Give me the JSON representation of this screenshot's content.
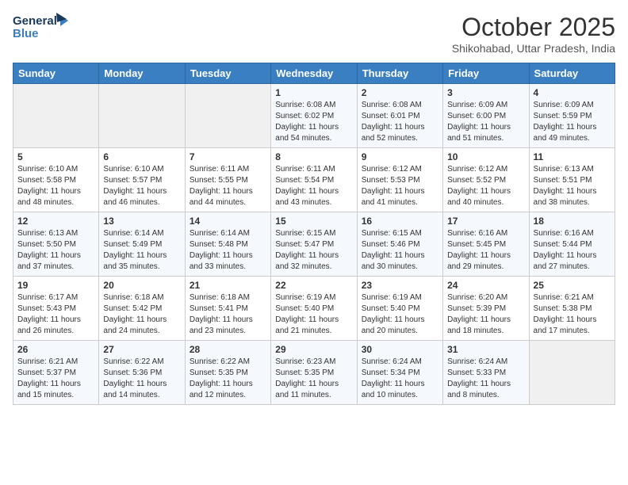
{
  "header": {
    "logo_line1": "General",
    "logo_line2": "Blue",
    "month": "October 2025",
    "location": "Shikohabad, Uttar Pradesh, India"
  },
  "weekdays": [
    "Sunday",
    "Monday",
    "Tuesday",
    "Wednesday",
    "Thursday",
    "Friday",
    "Saturday"
  ],
  "weeks": [
    [
      {
        "day": "",
        "info": ""
      },
      {
        "day": "",
        "info": ""
      },
      {
        "day": "",
        "info": ""
      },
      {
        "day": "1",
        "info": "Sunrise: 6:08 AM\nSunset: 6:02 PM\nDaylight: 11 hours\nand 54 minutes."
      },
      {
        "day": "2",
        "info": "Sunrise: 6:08 AM\nSunset: 6:01 PM\nDaylight: 11 hours\nand 52 minutes."
      },
      {
        "day": "3",
        "info": "Sunrise: 6:09 AM\nSunset: 6:00 PM\nDaylight: 11 hours\nand 51 minutes."
      },
      {
        "day": "4",
        "info": "Sunrise: 6:09 AM\nSunset: 5:59 PM\nDaylight: 11 hours\nand 49 minutes."
      }
    ],
    [
      {
        "day": "5",
        "info": "Sunrise: 6:10 AM\nSunset: 5:58 PM\nDaylight: 11 hours\nand 48 minutes."
      },
      {
        "day": "6",
        "info": "Sunrise: 6:10 AM\nSunset: 5:57 PM\nDaylight: 11 hours\nand 46 minutes."
      },
      {
        "day": "7",
        "info": "Sunrise: 6:11 AM\nSunset: 5:55 PM\nDaylight: 11 hours\nand 44 minutes."
      },
      {
        "day": "8",
        "info": "Sunrise: 6:11 AM\nSunset: 5:54 PM\nDaylight: 11 hours\nand 43 minutes."
      },
      {
        "day": "9",
        "info": "Sunrise: 6:12 AM\nSunset: 5:53 PM\nDaylight: 11 hours\nand 41 minutes."
      },
      {
        "day": "10",
        "info": "Sunrise: 6:12 AM\nSunset: 5:52 PM\nDaylight: 11 hours\nand 40 minutes."
      },
      {
        "day": "11",
        "info": "Sunrise: 6:13 AM\nSunset: 5:51 PM\nDaylight: 11 hours\nand 38 minutes."
      }
    ],
    [
      {
        "day": "12",
        "info": "Sunrise: 6:13 AM\nSunset: 5:50 PM\nDaylight: 11 hours\nand 37 minutes."
      },
      {
        "day": "13",
        "info": "Sunrise: 6:14 AM\nSunset: 5:49 PM\nDaylight: 11 hours\nand 35 minutes."
      },
      {
        "day": "14",
        "info": "Sunrise: 6:14 AM\nSunset: 5:48 PM\nDaylight: 11 hours\nand 33 minutes."
      },
      {
        "day": "15",
        "info": "Sunrise: 6:15 AM\nSunset: 5:47 PM\nDaylight: 11 hours\nand 32 minutes."
      },
      {
        "day": "16",
        "info": "Sunrise: 6:15 AM\nSunset: 5:46 PM\nDaylight: 11 hours\nand 30 minutes."
      },
      {
        "day": "17",
        "info": "Sunrise: 6:16 AM\nSunset: 5:45 PM\nDaylight: 11 hours\nand 29 minutes."
      },
      {
        "day": "18",
        "info": "Sunrise: 6:16 AM\nSunset: 5:44 PM\nDaylight: 11 hours\nand 27 minutes."
      }
    ],
    [
      {
        "day": "19",
        "info": "Sunrise: 6:17 AM\nSunset: 5:43 PM\nDaylight: 11 hours\nand 26 minutes."
      },
      {
        "day": "20",
        "info": "Sunrise: 6:18 AM\nSunset: 5:42 PM\nDaylight: 11 hours\nand 24 minutes."
      },
      {
        "day": "21",
        "info": "Sunrise: 6:18 AM\nSunset: 5:41 PM\nDaylight: 11 hours\nand 23 minutes."
      },
      {
        "day": "22",
        "info": "Sunrise: 6:19 AM\nSunset: 5:40 PM\nDaylight: 11 hours\nand 21 minutes."
      },
      {
        "day": "23",
        "info": "Sunrise: 6:19 AM\nSunset: 5:40 PM\nDaylight: 11 hours\nand 20 minutes."
      },
      {
        "day": "24",
        "info": "Sunrise: 6:20 AM\nSunset: 5:39 PM\nDaylight: 11 hours\nand 18 minutes."
      },
      {
        "day": "25",
        "info": "Sunrise: 6:21 AM\nSunset: 5:38 PM\nDaylight: 11 hours\nand 17 minutes."
      }
    ],
    [
      {
        "day": "26",
        "info": "Sunrise: 6:21 AM\nSunset: 5:37 PM\nDaylight: 11 hours\nand 15 minutes."
      },
      {
        "day": "27",
        "info": "Sunrise: 6:22 AM\nSunset: 5:36 PM\nDaylight: 11 hours\nand 14 minutes."
      },
      {
        "day": "28",
        "info": "Sunrise: 6:22 AM\nSunset: 5:35 PM\nDaylight: 11 hours\nand 12 minutes."
      },
      {
        "day": "29",
        "info": "Sunrise: 6:23 AM\nSunset: 5:35 PM\nDaylight: 11 hours\nand 11 minutes."
      },
      {
        "day": "30",
        "info": "Sunrise: 6:24 AM\nSunset: 5:34 PM\nDaylight: 11 hours\nand 10 minutes."
      },
      {
        "day": "31",
        "info": "Sunrise: 6:24 AM\nSunset: 5:33 PM\nDaylight: 11 hours\nand 8 minutes."
      },
      {
        "day": "",
        "info": ""
      }
    ]
  ]
}
